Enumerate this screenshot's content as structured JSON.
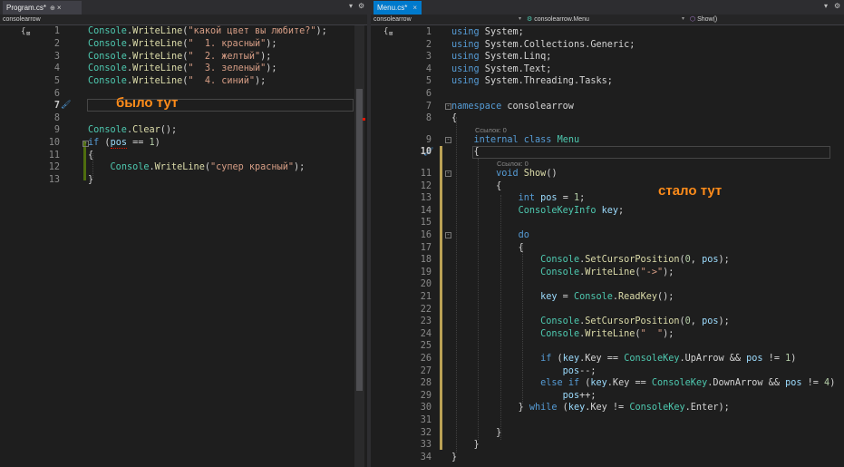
{
  "left": {
    "tab": {
      "label": "Program.cs*",
      "pin": "⊕",
      "close": "×"
    },
    "nav": {
      "project": "consolearrow"
    },
    "lines": [
      {
        "num": "1",
        "tokens": [
          [
            "cls",
            "Console"
          ],
          [
            "",
            "."
          ],
          [
            "m",
            "WriteLine"
          ],
          [
            "",
            "("
          ],
          [
            "s",
            "\"какой цвет вы любите?\""
          ],
          [
            "",
            ");"
          ]
        ]
      },
      {
        "num": "2",
        "tokens": [
          [
            "cls",
            "Console"
          ],
          [
            "",
            "."
          ],
          [
            "m",
            "WriteLine"
          ],
          [
            "",
            "("
          ],
          [
            "s",
            "\"  1. красный\""
          ],
          [
            "",
            ");"
          ]
        ]
      },
      {
        "num": "3",
        "tokens": [
          [
            "cls",
            "Console"
          ],
          [
            "",
            "."
          ],
          [
            "m",
            "WriteLine"
          ],
          [
            "",
            "("
          ],
          [
            "s",
            "\"  2. желтый\""
          ],
          [
            "",
            ");"
          ]
        ]
      },
      {
        "num": "4",
        "tokens": [
          [
            "cls",
            "Console"
          ],
          [
            "",
            "."
          ],
          [
            "m",
            "WriteLine"
          ],
          [
            "",
            "("
          ],
          [
            "s",
            "\"  3. зеленый\""
          ],
          [
            "",
            ");"
          ]
        ]
      },
      {
        "num": "5",
        "tokens": [
          [
            "cls",
            "Console"
          ],
          [
            "",
            "."
          ],
          [
            "m",
            "WriteLine"
          ],
          [
            "",
            "("
          ],
          [
            "s",
            "\"  4. синий\""
          ],
          [
            "",
            ");"
          ]
        ]
      },
      {
        "num": "6",
        "tokens": []
      },
      {
        "num": "7",
        "tokens": []
      },
      {
        "num": "8",
        "tokens": []
      },
      {
        "num": "9",
        "tokens": [
          [
            "cls",
            "Console"
          ],
          [
            "",
            "."
          ],
          [
            "m",
            "Clear"
          ],
          [
            "",
            "();"
          ]
        ]
      },
      {
        "num": "10",
        "tokens": [
          [
            "kw",
            "if"
          ],
          [
            "",
            " ("
          ],
          [
            "v squig",
            "pos"
          ],
          [
            "",
            " == "
          ],
          [
            "n",
            "1"
          ],
          [
            "",
            ")"
          ]
        ]
      },
      {
        "num": "11",
        "tokens": [
          [
            "",
            "{"
          ]
        ]
      },
      {
        "num": "12",
        "tokens": [
          [
            "",
            "    "
          ],
          [
            "cls",
            "Console"
          ],
          [
            "",
            "."
          ],
          [
            "m",
            "WriteLine"
          ],
          [
            "",
            "("
          ],
          [
            "s",
            "\"супер красный\""
          ],
          [
            "",
            ");"
          ]
        ]
      },
      {
        "num": "13",
        "tokens": [
          [
            "",
            "}"
          ]
        ]
      }
    ],
    "annotation": "было тут"
  },
  "right": {
    "tab": {
      "label": "Menu.cs*",
      "close": "×"
    },
    "nav": {
      "project": "consolearrow",
      "class": "consolearrow.Menu",
      "member": "Show()"
    },
    "codelens_1": "Ссылок: 0",
    "codelens_2": "Ссылок: 0",
    "lines": [
      {
        "num": "1",
        "tokens": [
          [
            "kw",
            "using"
          ],
          [
            "",
            " System;"
          ]
        ]
      },
      {
        "num": "2",
        "tokens": [
          [
            "kw",
            "using"
          ],
          [
            "",
            " System.Collections.Generic;"
          ]
        ]
      },
      {
        "num": "3",
        "tokens": [
          [
            "kw",
            "using"
          ],
          [
            "",
            " System.Linq;"
          ]
        ]
      },
      {
        "num": "4",
        "tokens": [
          [
            "kw",
            "using"
          ],
          [
            "",
            " System.Text;"
          ]
        ]
      },
      {
        "num": "5",
        "tokens": [
          [
            "kw",
            "using"
          ],
          [
            "",
            " System.Threading.Tasks;"
          ]
        ]
      },
      {
        "num": "6",
        "tokens": []
      },
      {
        "num": "7",
        "tokens": [
          [
            "kw",
            "namespace"
          ],
          [
            "",
            " consolearrow"
          ]
        ]
      },
      {
        "num": "8",
        "tokens": [
          [
            "",
            "{"
          ]
        ]
      },
      {
        "num": "9",
        "tokens": [
          [
            "",
            "    "
          ],
          [
            "kw",
            "internal"
          ],
          [
            "",
            " "
          ],
          [
            "kw",
            "class"
          ],
          [
            "",
            " "
          ],
          [
            "cls",
            "Menu"
          ]
        ]
      },
      {
        "num": "10",
        "tokens": [
          [
            "",
            "    {"
          ]
        ]
      },
      {
        "num": "11",
        "tokens": [
          [
            "",
            "        "
          ],
          [
            "kw",
            "void"
          ],
          [
            "",
            " "
          ],
          [
            "m",
            "Show"
          ],
          [
            "",
            "()"
          ]
        ]
      },
      {
        "num": "12",
        "tokens": [
          [
            "",
            "        {"
          ]
        ]
      },
      {
        "num": "13",
        "tokens": [
          [
            "",
            "            "
          ],
          [
            "kw",
            "int"
          ],
          [
            "",
            " "
          ],
          [
            "v",
            "pos"
          ],
          [
            "",
            " = "
          ],
          [
            "n",
            "1"
          ],
          [
            "",
            ";"
          ]
        ]
      },
      {
        "num": "14",
        "tokens": [
          [
            "",
            "            "
          ],
          [
            "cls",
            "ConsoleKeyInfo"
          ],
          [
            "",
            " "
          ],
          [
            "v",
            "key"
          ],
          [
            "",
            ";"
          ]
        ]
      },
      {
        "num": "15",
        "tokens": []
      },
      {
        "num": "16",
        "tokens": [
          [
            "",
            "            "
          ],
          [
            "kw",
            "do"
          ]
        ]
      },
      {
        "num": "17",
        "tokens": [
          [
            "",
            "            {"
          ]
        ]
      },
      {
        "num": "18",
        "tokens": [
          [
            "",
            "                "
          ],
          [
            "cls",
            "Console"
          ],
          [
            "",
            "."
          ],
          [
            "m",
            "SetCursorPosition"
          ],
          [
            "",
            "("
          ],
          [
            "n",
            "0"
          ],
          [
            "",
            ", "
          ],
          [
            "v",
            "pos"
          ],
          [
            "",
            ");"
          ]
        ]
      },
      {
        "num": "19",
        "tokens": [
          [
            "",
            "                "
          ],
          [
            "cls",
            "Console"
          ],
          [
            "",
            "."
          ],
          [
            "m",
            "WriteLine"
          ],
          [
            "",
            "("
          ],
          [
            "s",
            "\"->\""
          ],
          [
            "",
            ");"
          ]
        ]
      },
      {
        "num": "20",
        "tokens": []
      },
      {
        "num": "21",
        "tokens": [
          [
            "",
            "                "
          ],
          [
            "v",
            "key"
          ],
          [
            "",
            " = "
          ],
          [
            "cls",
            "Console"
          ],
          [
            "",
            "."
          ],
          [
            "m",
            "ReadKey"
          ],
          [
            "",
            "();"
          ]
        ]
      },
      {
        "num": "22",
        "tokens": []
      },
      {
        "num": "23",
        "tokens": [
          [
            "",
            "                "
          ],
          [
            "cls",
            "Console"
          ],
          [
            "",
            "."
          ],
          [
            "m",
            "SetCursorPosition"
          ],
          [
            "",
            "("
          ],
          [
            "n",
            "0"
          ],
          [
            "",
            ", "
          ],
          [
            "v",
            "pos"
          ],
          [
            "",
            ");"
          ]
        ]
      },
      {
        "num": "24",
        "tokens": [
          [
            "",
            "                "
          ],
          [
            "cls",
            "Console"
          ],
          [
            "",
            "."
          ],
          [
            "m",
            "WriteLine"
          ],
          [
            "",
            "("
          ],
          [
            "s",
            "\"  \""
          ],
          [
            "",
            ");"
          ]
        ]
      },
      {
        "num": "25",
        "tokens": []
      },
      {
        "num": "26",
        "tokens": [
          [
            "",
            "                "
          ],
          [
            "kw",
            "if"
          ],
          [
            "",
            " ("
          ],
          [
            "v",
            "key"
          ],
          [
            "",
            ".Key == "
          ],
          [
            "cls",
            "ConsoleKey"
          ],
          [
            "",
            ".UpArrow && "
          ],
          [
            "v",
            "pos"
          ],
          [
            "",
            " != "
          ],
          [
            "n",
            "1"
          ],
          [
            "",
            ")"
          ]
        ]
      },
      {
        "num": "27",
        "tokens": [
          [
            "",
            "                    "
          ],
          [
            "v",
            "pos"
          ],
          [
            "",
            "--;"
          ]
        ]
      },
      {
        "num": "28",
        "tokens": [
          [
            "",
            "                "
          ],
          [
            "kw",
            "else"
          ],
          [
            "",
            " "
          ],
          [
            "kw",
            "if"
          ],
          [
            "",
            " ("
          ],
          [
            "v",
            "key"
          ],
          [
            "",
            ".Key == "
          ],
          [
            "cls",
            "ConsoleKey"
          ],
          [
            "",
            ".DownArrow && "
          ],
          [
            "v",
            "pos"
          ],
          [
            "",
            " != "
          ],
          [
            "n",
            "4"
          ],
          [
            "",
            ")"
          ]
        ]
      },
      {
        "num": "29",
        "tokens": [
          [
            "",
            "                    "
          ],
          [
            "v",
            "pos"
          ],
          [
            "",
            "++;"
          ]
        ]
      },
      {
        "num": "30",
        "tokens": [
          [
            "",
            "            } "
          ],
          [
            "kw",
            "while"
          ],
          [
            "",
            " ("
          ],
          [
            "v",
            "key"
          ],
          [
            "",
            ".Key != "
          ],
          [
            "cls",
            "ConsoleKey"
          ],
          [
            "",
            ".Enter);"
          ]
        ]
      },
      {
        "num": "31",
        "tokens": []
      },
      {
        "num": "32",
        "tokens": [
          [
            "",
            "        }"
          ]
        ]
      },
      {
        "num": "33",
        "tokens": [
          [
            "",
            "    }"
          ]
        ]
      },
      {
        "num": "34",
        "tokens": [
          [
            "",
            "}"
          ]
        ]
      }
    ],
    "annotation": "стало тут"
  }
}
